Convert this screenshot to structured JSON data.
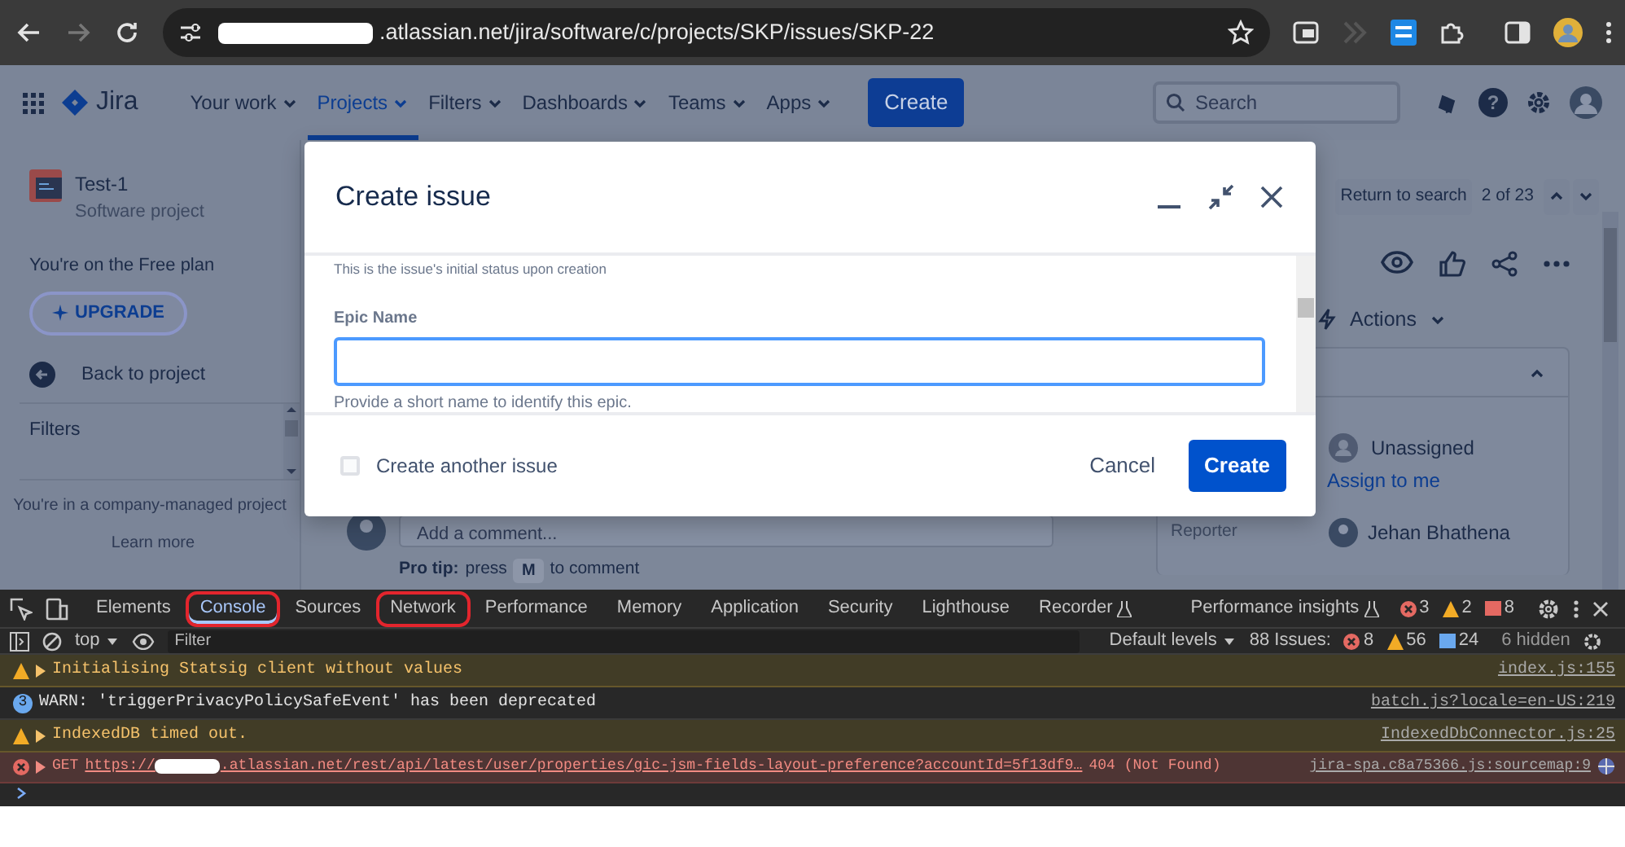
{
  "browser": {
    "url": ".atlassian.net/jira/software/c/projects/SKP/issues/SKP-22",
    "forward_disabled": true
  },
  "jira_nav": {
    "product": "Jira",
    "items": [
      {
        "label": "Your work",
        "selected": false
      },
      {
        "label": "Projects",
        "selected": true
      },
      {
        "label": "Filters",
        "selected": false
      },
      {
        "label": "Dashboards",
        "selected": false
      },
      {
        "label": "Teams",
        "selected": false
      },
      {
        "label": "Apps",
        "selected": false
      }
    ],
    "create_button": "Create",
    "search": {
      "placeholder": "Search"
    },
    "help_glyph": "?"
  },
  "sidebar": {
    "project_name": "Test-1",
    "project_type": "Software project",
    "plan_note": "You're on the Free plan",
    "upgrade_button": "UPGRADE",
    "back_link": "Back to project",
    "section": "Filters",
    "footer_note": "You're in a company-managed project",
    "learn_more": "Learn more"
  },
  "issue_view": {
    "return_button": "Return to search",
    "position": "2 of 23",
    "actions": "Actions",
    "assignee": "Unassigned",
    "assign_link": "Assign to me",
    "reporter_label": "Reporter",
    "reporter": "Jehan Bhathena",
    "comment_placeholder": "Add a comment...",
    "tip_label": "Pro tip:",
    "tip_before": "press",
    "tip_key": "M",
    "tip_after": "to comment"
  },
  "create_issue_dialog": {
    "title": "Create issue",
    "status_hint": "This is the issue's initial status upon creation",
    "field": {
      "label": "Epic Name",
      "focused": true,
      "help": "Provide a short name to identify this epic."
    },
    "create_another": {
      "label": "Create another issue",
      "checked": false
    },
    "buttons": [
      {
        "label": "Cancel",
        "kind": "subtle"
      },
      {
        "label": "Create",
        "kind": "primary"
      }
    ]
  },
  "devtools": {
    "tabs": [
      {
        "label": "Elements",
        "selected": false,
        "annotated": false,
        "experimental": false
      },
      {
        "label": "Console",
        "selected": true,
        "annotated": true,
        "experimental": false
      },
      {
        "label": "Sources",
        "selected": false,
        "annotated": false,
        "experimental": false
      },
      {
        "label": "Network",
        "selected": false,
        "annotated": true,
        "experimental": false
      },
      {
        "label": "Performance",
        "selected": false,
        "annotated": false,
        "experimental": false
      },
      {
        "label": "Memory",
        "selected": false,
        "annotated": false,
        "experimental": false
      },
      {
        "label": "Application",
        "selected": false,
        "annotated": false,
        "experimental": false
      },
      {
        "label": "Security",
        "selected": false,
        "annotated": false,
        "experimental": false
      },
      {
        "label": "Lighthouse",
        "selected": false,
        "annotated": false,
        "experimental": false
      },
      {
        "label": "Recorder",
        "selected": false,
        "annotated": false,
        "experimental": true
      },
      {
        "label": "Performance insights",
        "selected": false,
        "annotated": false,
        "experimental": true
      }
    ],
    "counts": [
      {
        "kind": "error",
        "count": "3"
      },
      {
        "kind": "warning",
        "count": "2"
      },
      {
        "kind": "issue",
        "count": "8"
      }
    ],
    "context": "top",
    "filter_placeholder": "Filter",
    "levels": "Default levels",
    "issues_label": "88 Issues:",
    "issue_counts": [
      {
        "kind": "error",
        "count": "8"
      },
      {
        "kind": "warning",
        "count": "56"
      },
      {
        "kind": "info",
        "count": "24"
      }
    ],
    "hidden": "6 hidden",
    "messages": [
      {
        "kind": "warning",
        "text": "Initialising Statsig client without values",
        "source": "index.js:155"
      },
      {
        "kind": "log",
        "repeat": "3",
        "text": "WARN: 'triggerPrivacyPolicySafeEvent' has been deprecated",
        "source": "batch.js?locale=en-US:219"
      },
      {
        "kind": "warning",
        "text": "IndexedDB timed out.",
        "source": "IndexedDbConnector.js:25"
      },
      {
        "kind": "error",
        "method": "GET",
        "url_start": "https://",
        "url_rest": ".atlassian.net/rest/api/latest/user/properties/gic-jsm-fields-layout-preference?accountId=5f13df9…",
        "status": "404 (Not Found)",
        "source": "jira-spa.c8a75366.js:sourcemap:9"
      }
    ]
  }
}
